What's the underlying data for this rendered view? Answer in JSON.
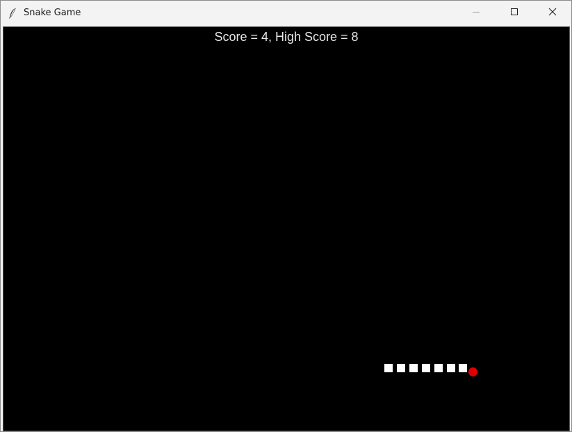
{
  "window": {
    "title": "Snake Game",
    "icon": "feather-icon",
    "controls": [
      "minimize-icon",
      "maximize-icon",
      "close-icon"
    ]
  },
  "game": {
    "score_text": "Score = 4, High Score = 8",
    "colors": {
      "background": "#000000",
      "snake": "#ffffff",
      "food": "#e00000",
      "score_text": "#e6e6e6"
    },
    "snake_length": 7
  }
}
